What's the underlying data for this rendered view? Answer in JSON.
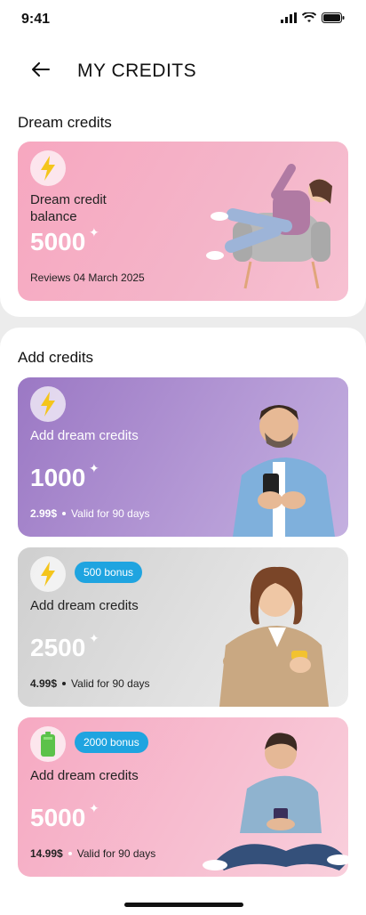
{
  "status": {
    "time": "9:41"
  },
  "header": {
    "title": "MY CREDITS"
  },
  "dream_section": {
    "title": "Dream credits",
    "card": {
      "label": "Dream credit balance",
      "amount": "5000",
      "footer": "Reviews 04 March 2025"
    }
  },
  "add_section": {
    "title": "Add credits",
    "cards": [
      {
        "label": "Add dream credits",
        "amount": "1000",
        "price": "2.99$",
        "validity": "Valid for 90 days",
        "bonus": ""
      },
      {
        "label": "Add dream credits",
        "amount": "2500",
        "price": "4.99$",
        "validity": "Valid for 90 days",
        "bonus": "500 bonus"
      },
      {
        "label": "Add dream credits",
        "amount": "5000",
        "price": "14.99$",
        "validity": "Valid for 90 days",
        "bonus": "2000 bonus"
      }
    ]
  },
  "colors": {
    "badge": "#1fa4e0",
    "lightning": "#f4c51c",
    "battery": "#5cc24a"
  },
  "icons": [
    "back-arrow-icon",
    "lightning-icon",
    "battery-icon",
    "sparkle-icon",
    "signal-icon",
    "wifi-icon",
    "battery-status-icon"
  ]
}
